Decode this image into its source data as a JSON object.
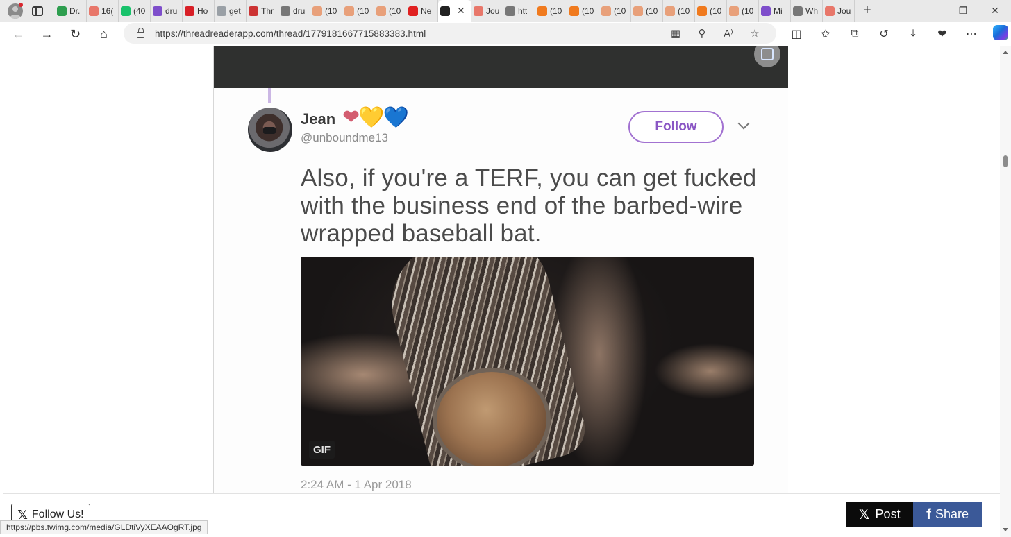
{
  "browser": {
    "tabs": [
      {
        "title": "Dr.",
        "icon": "play-icon",
        "color": "#2e9e4f"
      },
      {
        "title": "16(",
        "icon": "bi-icon",
        "color": "#e8776a"
      },
      {
        "title": "(40",
        "icon": "g-icon",
        "color": "#19c26b"
      },
      {
        "title": "dru",
        "icon": "yahoo-icon",
        "color": "#7e4ecb"
      },
      {
        "title": "Ho",
        "icon": "red-icon",
        "color": "#d81f26"
      },
      {
        "title": "get",
        "icon": "search-icon",
        "color": "#9aa0a6"
      },
      {
        "title": "Thr",
        "icon": "ds-icon",
        "color": "#c33"
      },
      {
        "title": "dru",
        "icon": "page-icon",
        "color": "#777"
      },
      {
        "title": "(10",
        "icon": "bookmark-icon",
        "color": "#e8a07a"
      },
      {
        "title": "(10",
        "icon": "bookmark-icon",
        "color": "#e8a07a"
      },
      {
        "title": "(10",
        "icon": "bookmark-icon",
        "color": "#e8a07a"
      },
      {
        "title": "Ne",
        "icon": "r-icon",
        "color": "#e02020"
      },
      {
        "title": "",
        "icon": "tr-icon",
        "color": "#222",
        "active": true
      },
      {
        "title": "Jou",
        "icon": "youtube-icon",
        "color": "#e8776a"
      },
      {
        "title": "htt",
        "icon": "page-icon",
        "color": "#777"
      },
      {
        "title": "(10",
        "icon": "bookmark-icon",
        "color": "#f07a1e"
      },
      {
        "title": "(10",
        "icon": "bookmark-icon",
        "color": "#f07a1e"
      },
      {
        "title": "(10",
        "icon": "bookmark-icon",
        "color": "#e8a07a"
      },
      {
        "title": "(10",
        "icon": "bookmark-icon",
        "color": "#e8a07a"
      },
      {
        "title": "(10",
        "icon": "bookmark-icon",
        "color": "#e8a07a"
      },
      {
        "title": "(10",
        "icon": "bookmark-icon",
        "color": "#f07a1e"
      },
      {
        "title": "(10",
        "icon": "bookmark-icon",
        "color": "#e8a07a"
      },
      {
        "title": "Mi",
        "icon": "yahoo-icon",
        "color": "#7e4ecb"
      },
      {
        "title": "Wh",
        "icon": "page-icon",
        "color": "#777"
      },
      {
        "title": "Jou",
        "icon": "youtube-icon",
        "color": "#e8776a"
      }
    ],
    "url": "https://threadreaderapp.com/thread/1779181667715883383.html",
    "status_url": "https://pbs.twimg.com/media/GLDtiVyXEAAOgRT.jpg"
  },
  "tweet": {
    "name": "Jean",
    "hearts": [
      "❤",
      "💛",
      "💙"
    ],
    "handle": "@unboundme13",
    "follow_label": "Follow",
    "text": "Also, if you're a TERF, you can get fucked with the business end of the barbed-wire wrapped baseball bat.",
    "media_label": "GIF",
    "timestamp": "2:24 AM - 1 Apr 2018",
    "accent_color": "#a272d1"
  },
  "footer": {
    "follow_us": "Follow Us!",
    "post": "Post",
    "share": "Share"
  }
}
